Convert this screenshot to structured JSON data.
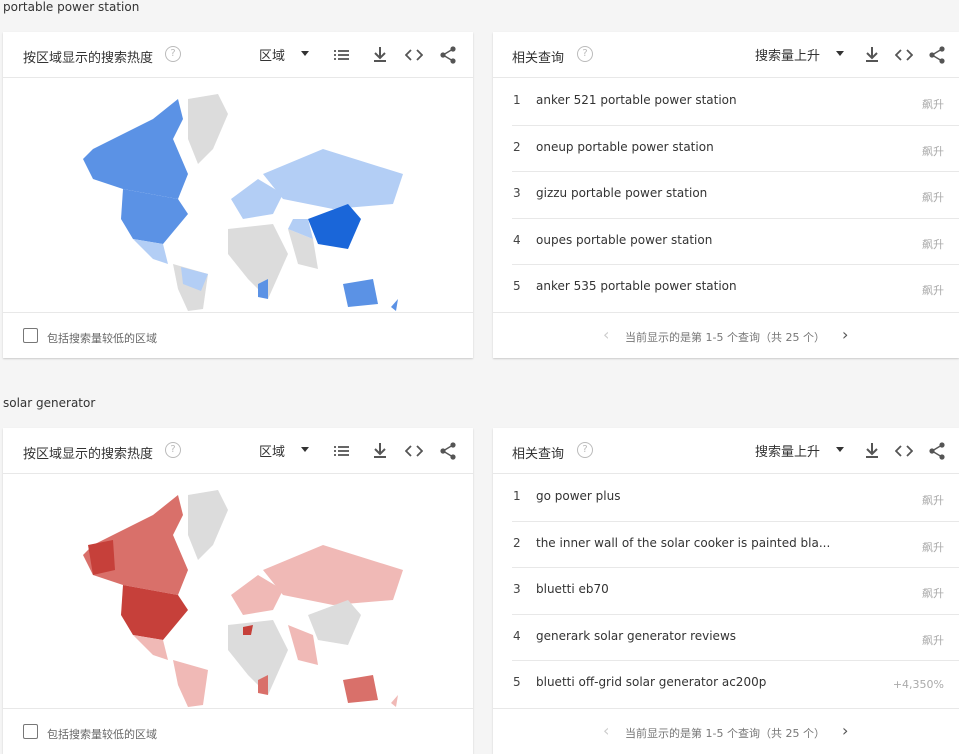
{
  "sections": [
    {
      "title": "portable power station",
      "map_card": {
        "title": "按区域显示的搜索热度",
        "help": "?",
        "dropdown": "区域",
        "checkbox_label": "包括搜索量较低的区域",
        "highlight_color": "#1a66d9",
        "medium_color": "#5b92e5",
        "light_color": "#b3cef5"
      },
      "queries_card": {
        "title": "相关查询",
        "help": "?",
        "dropdown": "搜索量上升",
        "rows": [
          {
            "num": "1",
            "text": "anker 521 portable power station",
            "value": "飙升"
          },
          {
            "num": "2",
            "text": "oneup portable power station",
            "value": "飙升"
          },
          {
            "num": "3",
            "text": "gizzu portable power station",
            "value": "飙升"
          },
          {
            "num": "4",
            "text": "oupes portable power station",
            "value": "飙升"
          },
          {
            "num": "5",
            "text": "anker 535 portable power station",
            "value": "飙升"
          }
        ],
        "pager": "当前显示的是第 1-5 个查询（共 25 个）"
      }
    },
    {
      "title": "solar generator",
      "map_card": {
        "title": "按区域显示的搜索热度",
        "help": "?",
        "dropdown": "区域",
        "checkbox_label": "包括搜索量较低的区域",
        "highlight_color": "#c6403a",
        "medium_color": "#d9706a",
        "light_color": "#f0b9b6"
      },
      "queries_card": {
        "title": "相关查询",
        "help": "?",
        "dropdown": "搜索量上升",
        "rows": [
          {
            "num": "1",
            "text": "go power plus",
            "value": "飙升"
          },
          {
            "num": "2",
            "text": "the inner wall of the solar cooker is painted bla...",
            "value": "飙升"
          },
          {
            "num": "3",
            "text": "bluetti eb70",
            "value": "飙升"
          },
          {
            "num": "4",
            "text": "generark solar generator reviews",
            "value": "飙升"
          },
          {
            "num": "5",
            "text": "bluetti off-grid solar generator ac200p",
            "value": "+4,350%"
          }
        ],
        "pager": "当前显示的是第 1-5 个查询（共 25 个）"
      }
    }
  ]
}
